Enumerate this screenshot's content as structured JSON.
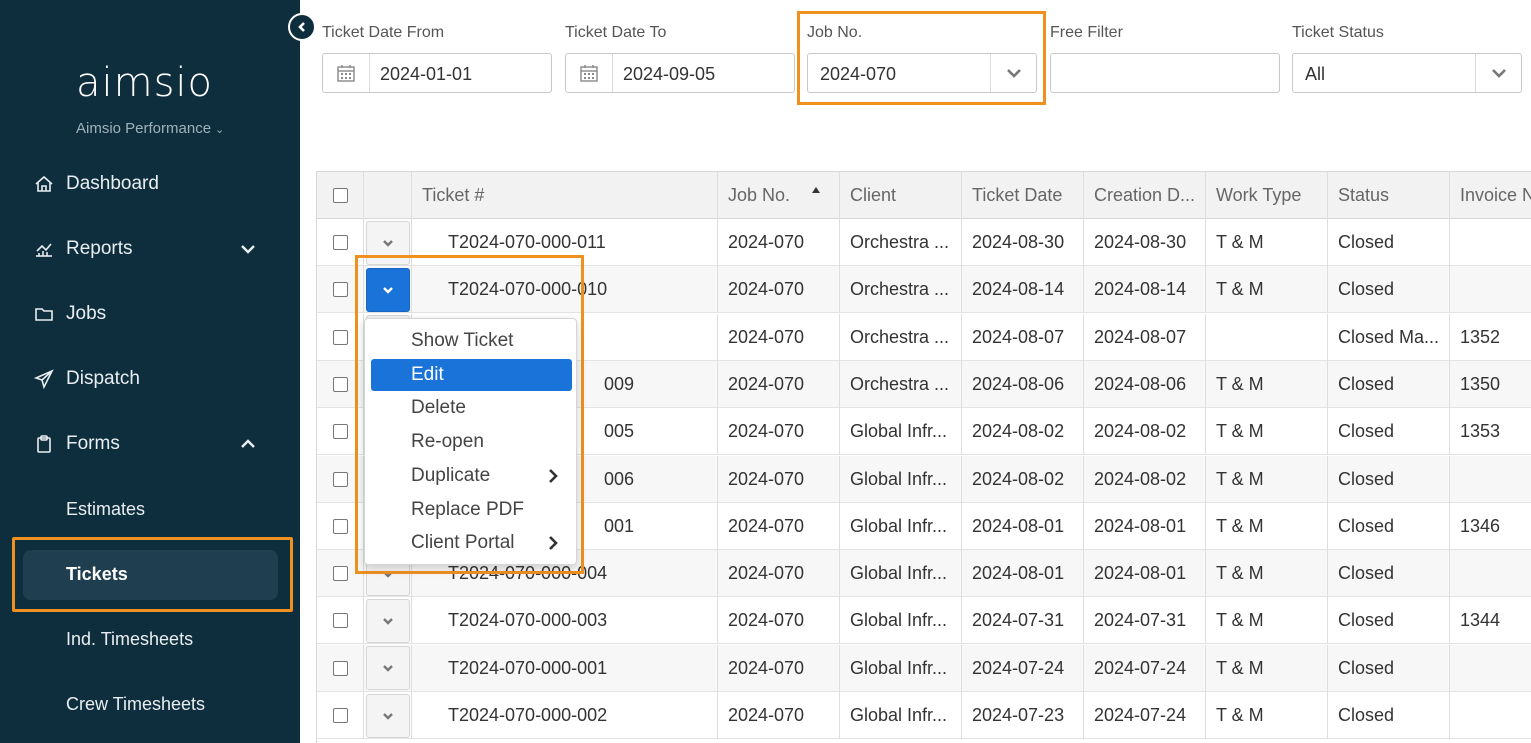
{
  "sidebar": {
    "logo": "aimsio",
    "org": "Aimsio Performance",
    "items": [
      {
        "label": "Dashboard",
        "icon": "home-icon"
      },
      {
        "label": "Reports",
        "icon": "chart-icon"
      },
      {
        "label": "Jobs",
        "icon": "folder-icon"
      },
      {
        "label": "Dispatch",
        "icon": "send-icon"
      },
      {
        "label": "Forms",
        "icon": "clipboard-icon"
      }
    ],
    "sub": {
      "estimates": "Estimates",
      "tickets": "Tickets",
      "ind_timesheets": "Ind. Timesheets",
      "crew_timesheets": "Crew Timesheets"
    }
  },
  "filters": {
    "date_from": {
      "label": "Ticket Date From",
      "value": "2024-01-01"
    },
    "date_to": {
      "label": "Ticket Date To",
      "value": "2024-09-05"
    },
    "job_no": {
      "label": "Job No.",
      "value": "2024-070"
    },
    "free_filter": {
      "label": "Free Filter",
      "value": ""
    },
    "status": {
      "label": "Ticket Status",
      "value": "All"
    }
  },
  "grid": {
    "columns": [
      "Ticket #",
      "Job No.",
      "Client",
      "Ticket Date",
      "Creation D...",
      "Work Type",
      "Status",
      "Invoice N"
    ],
    "rows": [
      {
        "ticket": "T2024-070-000-011",
        "job": "2024-070",
        "client": "Orchestra ...",
        "date": "2024-08-30",
        "created": "2024-08-30",
        "work": "T & M",
        "status": "Closed",
        "invoice": ""
      },
      {
        "ticket": "T2024-070-000-010",
        "job": "2024-070",
        "client": "Orchestra ...",
        "date": "2024-08-14",
        "created": "2024-08-14",
        "work": "T & M",
        "status": "Closed",
        "invoice": ""
      },
      {
        "ticket": "",
        "job": "2024-070",
        "client": "Orchestra ...",
        "date": "2024-08-07",
        "created": "2024-08-07",
        "work": "",
        "status": "Closed Ma...",
        "invoice": "1352"
      },
      {
        "ticket": "009",
        "job": "2024-070",
        "client": "Orchestra ...",
        "date": "2024-08-06",
        "created": "2024-08-06",
        "work": "T & M",
        "status": "Closed",
        "invoice": "1350"
      },
      {
        "ticket": "005",
        "job": "2024-070",
        "client": "Global Infr...",
        "date": "2024-08-02",
        "created": "2024-08-02",
        "work": "T & M",
        "status": "Closed",
        "invoice": "1353"
      },
      {
        "ticket": "006",
        "job": "2024-070",
        "client": "Global Infr...",
        "date": "2024-08-02",
        "created": "2024-08-02",
        "work": "T & M",
        "status": "Closed",
        "invoice": ""
      },
      {
        "ticket": "001",
        "job": "2024-070",
        "client": "Global Infr...",
        "date": "2024-08-01",
        "created": "2024-08-01",
        "work": "T & M",
        "status": "Closed",
        "invoice": "1346"
      },
      {
        "ticket": "T2024-070-000-004",
        "job": "2024-070",
        "client": "Global Infr...",
        "date": "2024-08-01",
        "created": "2024-08-01",
        "work": "T & M",
        "status": "Closed",
        "invoice": ""
      },
      {
        "ticket": "T2024-070-000-003",
        "job": "2024-070",
        "client": "Global Infr...",
        "date": "2024-07-31",
        "created": "2024-07-31",
        "work": "T & M",
        "status": "Closed",
        "invoice": "1344"
      },
      {
        "ticket": "T2024-070-000-001",
        "job": "2024-070",
        "client": "Global Infr...",
        "date": "2024-07-24",
        "created": "2024-07-24",
        "work": "T & M",
        "status": "Closed",
        "invoice": ""
      },
      {
        "ticket": "T2024-070-000-002",
        "job": "2024-070",
        "client": "Global Infr...",
        "date": "2024-07-23",
        "created": "2024-07-24",
        "work": "T & M",
        "status": "Closed",
        "invoice": ""
      }
    ]
  },
  "menu": {
    "items": [
      "Show Ticket",
      "Edit",
      "Delete",
      "Re-open",
      "Duplicate",
      "Replace PDF",
      "Client Portal"
    ]
  }
}
